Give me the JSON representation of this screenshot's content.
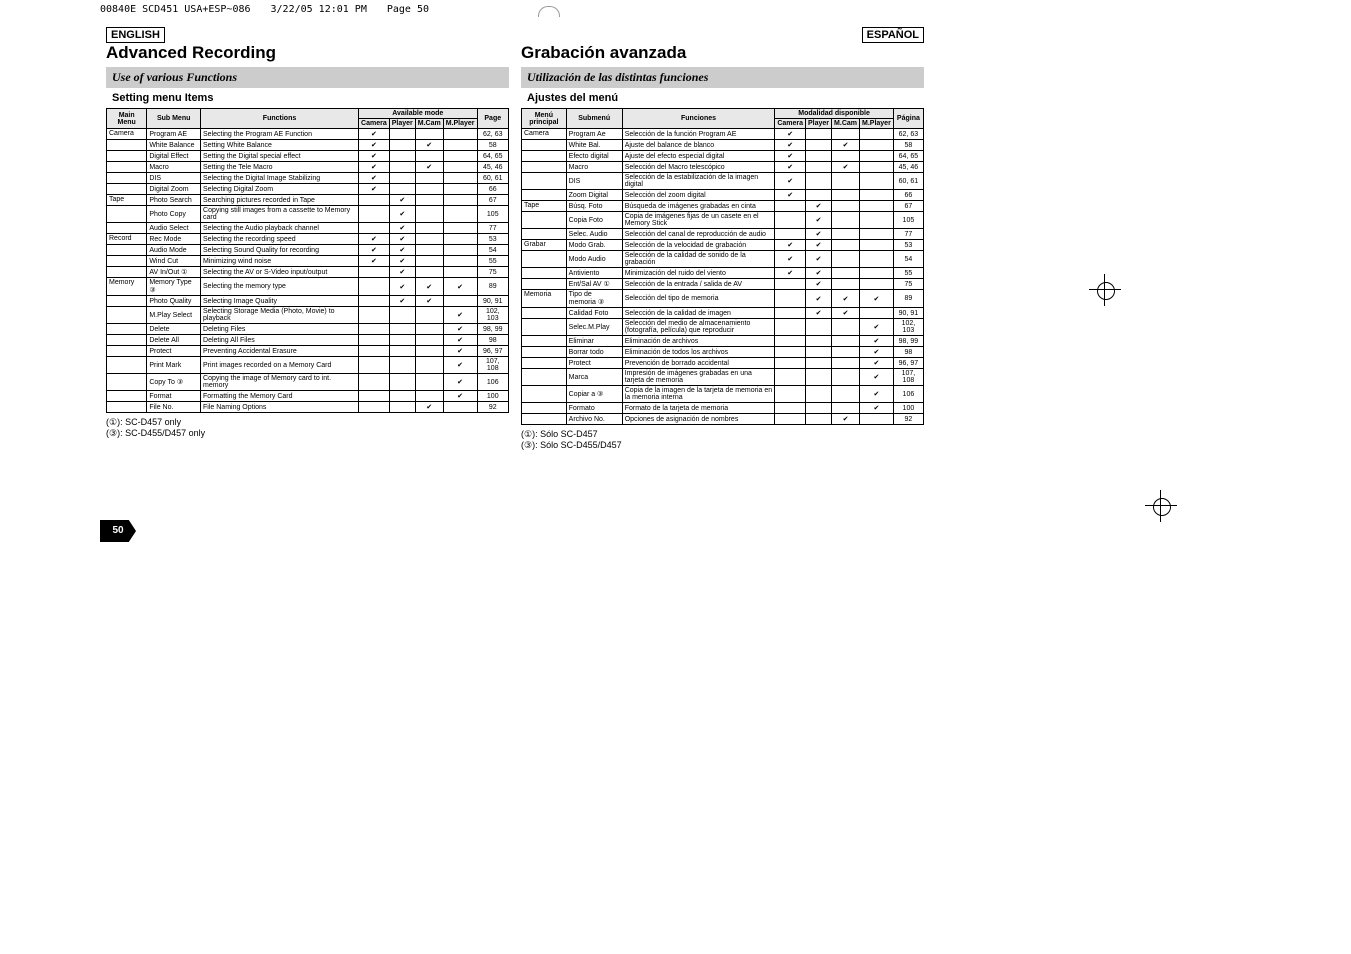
{
  "meta": {
    "filename": "00840E SCD451 USA+ESP~086",
    "date": "3/22/05 12:01 PM",
    "pg": "Page 50"
  },
  "pageNumber": "50",
  "helper": {
    "check": "✔"
  },
  "left": {
    "lang": "ENGLISH",
    "title": "Advanced Recording",
    "subtitle": "Use of various Functions",
    "section": "Setting menu Items",
    "headers": {
      "main": "Main Menu",
      "sub": "Sub Menu",
      "func": "Functions",
      "avail": "Available mode",
      "cam": "Camera",
      "player": "Player",
      "mcam": "M.Cam",
      "mplayer": "M.Player",
      "page": "Page"
    },
    "rows": [
      {
        "main": "Camera",
        "sub": "Program AE",
        "func": "Selecting the Program AE Function",
        "m": [
          1,
          0,
          0,
          0
        ],
        "pg": "62, 63"
      },
      {
        "main": "",
        "sub": "White Balance",
        "func": "Setting White Balance",
        "m": [
          1,
          0,
          1,
          0
        ],
        "pg": "58"
      },
      {
        "main": "",
        "sub": "Digital Effect",
        "func": "Setting the Digital special effect",
        "m": [
          1,
          0,
          0,
          0
        ],
        "pg": "64, 65"
      },
      {
        "main": "",
        "sub": "Macro",
        "func": "Setting the Tele Macro",
        "m": [
          1,
          0,
          1,
          0
        ],
        "pg": "45, 46"
      },
      {
        "main": "",
        "sub": "DIS",
        "func": "Selecting the Digital Image Stabilizing",
        "m": [
          1,
          0,
          0,
          0
        ],
        "pg": "60, 61"
      },
      {
        "main": "",
        "sub": "Digital Zoom",
        "func": "Selecting Digital Zoom",
        "m": [
          1,
          0,
          0,
          0
        ],
        "pg": "66"
      },
      {
        "main": "Tape",
        "sub": "Photo Search",
        "func": "Searching pictures recorded in Tape",
        "m": [
          0,
          1,
          0,
          0
        ],
        "pg": "67"
      },
      {
        "main": "",
        "sub": "Photo Copy",
        "func": "Copying still images from a cassette to Memory card",
        "m": [
          0,
          1,
          0,
          0
        ],
        "pg": "105"
      },
      {
        "main": "",
        "sub": "Audio Select",
        "func": "Selecting the Audio playback channel",
        "m": [
          0,
          1,
          0,
          0
        ],
        "pg": "77"
      },
      {
        "main": "Record",
        "sub": "Rec Mode",
        "func": "Selecting the recording speed",
        "m": [
          1,
          1,
          0,
          0
        ],
        "pg": "53"
      },
      {
        "main": "",
        "sub": "Audio Mode",
        "func": "Selecting Sound Quality for recording",
        "m": [
          1,
          1,
          0,
          0
        ],
        "pg": "54"
      },
      {
        "main": "",
        "sub": "Wind Cut",
        "func": "Minimizing wind noise",
        "m": [
          1,
          1,
          0,
          0
        ],
        "pg": "55"
      },
      {
        "main": "",
        "sub": "AV In/Out ①",
        "func": "Selecting the AV or S-Video input/output",
        "m": [
          0,
          1,
          0,
          0
        ],
        "pg": "75"
      },
      {
        "main": "Memory",
        "sub": "Memory Type ③",
        "func": "Selecting the memory type",
        "m": [
          0,
          1,
          1,
          1
        ],
        "pg": "89"
      },
      {
        "main": "",
        "sub": "Photo Quality",
        "func": "Selecting Image Quality",
        "m": [
          0,
          1,
          1,
          0
        ],
        "pg": "90, 91"
      },
      {
        "main": "",
        "sub": "M.Play Select",
        "func": "Selecting Storage Media (Photo, Movie) to playback",
        "m": [
          0,
          0,
          0,
          1
        ],
        "pg": "102, 103"
      },
      {
        "main": "",
        "sub": "Delete",
        "func": "Deleting Files",
        "m": [
          0,
          0,
          0,
          1
        ],
        "pg": "98, 99"
      },
      {
        "main": "",
        "sub": "Delete All",
        "func": "Deleting All Files",
        "m": [
          0,
          0,
          0,
          1
        ],
        "pg": "98"
      },
      {
        "main": "",
        "sub": "Protect",
        "func": "Preventing Accidental Erasure",
        "m": [
          0,
          0,
          0,
          1
        ],
        "pg": "96, 97"
      },
      {
        "main": "",
        "sub": "Print Mark",
        "func": "Print images recorded on a Memory Card",
        "m": [
          0,
          0,
          0,
          1
        ],
        "pg": "107, 108"
      },
      {
        "main": "",
        "sub": "Copy To ③",
        "func": "Copying the image of Memory card to int. memory",
        "m": [
          0,
          0,
          0,
          1
        ],
        "pg": "106"
      },
      {
        "main": "",
        "sub": "Format",
        "func": "Formatting the Memory Card",
        "m": [
          0,
          0,
          0,
          1
        ],
        "pg": "100"
      },
      {
        "main": "",
        "sub": "File No.",
        "func": "File Naming Options",
        "m": [
          0,
          0,
          1,
          0
        ],
        "pg": "92"
      }
    ],
    "notes": [
      "(①): SC-D457 only",
      "(③): SC-D455/D457 only"
    ]
  },
  "right": {
    "lang": "ESPAÑOL",
    "title": "Grabación avanzada",
    "subtitle": "Utilización de las distintas funciones",
    "section": "Ajustes del menú",
    "headers": {
      "main": "Menú principal",
      "sub": "Submenú",
      "func": "Funciones",
      "avail": "Modalidad disponible",
      "cam": "Camera",
      "player": "Player",
      "mcam": "M.Cam",
      "mplayer": "M.Player",
      "page": "Página"
    },
    "rows": [
      {
        "main": "Camera",
        "sub": "Program Ae",
        "func": "Selección de la función Program AE",
        "m": [
          1,
          0,
          0,
          0
        ],
        "pg": "62, 63"
      },
      {
        "main": "",
        "sub": "White Bal.",
        "func": "Ajuste del balance de blanco",
        "m": [
          1,
          0,
          1,
          0
        ],
        "pg": "58"
      },
      {
        "main": "",
        "sub": "Efecto digital",
        "func": "Ajuste del efecto especial digital",
        "m": [
          1,
          0,
          0,
          0
        ],
        "pg": "64, 65"
      },
      {
        "main": "",
        "sub": "Macro",
        "func": "Selección del Macro telescópico",
        "m": [
          1,
          0,
          1,
          0
        ],
        "pg": "45, 46"
      },
      {
        "main": "",
        "sub": "DIS",
        "func": "Selección de la estabilización de la imagen digital",
        "m": [
          1,
          0,
          0,
          0
        ],
        "pg": "60, 61"
      },
      {
        "main": "",
        "sub": "Zoom Digital",
        "func": "Selección del zoom digital",
        "m": [
          1,
          0,
          0,
          0
        ],
        "pg": "66"
      },
      {
        "main": "Tape",
        "sub": "Búsq. Foto",
        "func": "Búsqueda de imágenes grabadas en cinta",
        "m": [
          0,
          1,
          0,
          0
        ],
        "pg": "67"
      },
      {
        "main": "",
        "sub": "Copia Foto",
        "func": "Copia de imágenes fijas de un casete en el Memory Stick",
        "m": [
          0,
          1,
          0,
          0
        ],
        "pg": "105"
      },
      {
        "main": "",
        "sub": "Selec. Audio",
        "func": "Selección del canal de reproducción de audio",
        "m": [
          0,
          1,
          0,
          0
        ],
        "pg": "77"
      },
      {
        "main": "Grabar",
        "sub": "Modo Grab.",
        "func": "Selección de la velocidad de grabación",
        "m": [
          1,
          1,
          0,
          0
        ],
        "pg": "53"
      },
      {
        "main": "",
        "sub": "Modo Audio",
        "func": "Selección de la calidad de sonido de la grabación",
        "m": [
          1,
          1,
          0,
          0
        ],
        "pg": "54"
      },
      {
        "main": "",
        "sub": "Antiviento",
        "func": "Minimización del ruido del viento",
        "m": [
          1,
          1,
          0,
          0
        ],
        "pg": "55"
      },
      {
        "main": "",
        "sub": "Ent/Sal AV ①",
        "func": "Selección de la entrada / salida de AV",
        "m": [
          0,
          1,
          0,
          0
        ],
        "pg": "75"
      },
      {
        "main": "Memoria",
        "sub": "Tipo de memoria ③",
        "func": "Selección del tipo de memoria",
        "m": [
          0,
          1,
          1,
          1
        ],
        "pg": "89"
      },
      {
        "main": "",
        "sub": "Calidad Foto",
        "func": "Selección de la calidad de imagen",
        "m": [
          0,
          1,
          1,
          0
        ],
        "pg": "90, 91"
      },
      {
        "main": "",
        "sub": "Selec.M.Play",
        "func": "Selección del medio de almacenamiento (fotografía, película) que reproducir",
        "m": [
          0,
          0,
          0,
          1
        ],
        "pg": "102, 103"
      },
      {
        "main": "",
        "sub": "Eliminar",
        "func": "Eliminación de archivos",
        "m": [
          0,
          0,
          0,
          1
        ],
        "pg": "98, 99"
      },
      {
        "main": "",
        "sub": "Borrar todo",
        "func": "Eliminación de todos los archivos",
        "m": [
          0,
          0,
          0,
          1
        ],
        "pg": "98"
      },
      {
        "main": "",
        "sub": "Protect",
        "func": "Prevención de borrado accidental",
        "m": [
          0,
          0,
          0,
          1
        ],
        "pg": "96, 97"
      },
      {
        "main": "",
        "sub": "Marca",
        "func": "Impresión de imágenes grabadas en una tarjeta de memoria",
        "m": [
          0,
          0,
          0,
          1
        ],
        "pg": "107, 108"
      },
      {
        "main": "",
        "sub": "Copiar a ③",
        "func": "Copia de la imagen de la tarjeta de memoria en la memoria interna",
        "m": [
          0,
          0,
          0,
          1
        ],
        "pg": "106"
      },
      {
        "main": "",
        "sub": "Formato",
        "func": "Formato de la tarjeta de memoria",
        "m": [
          0,
          0,
          0,
          1
        ],
        "pg": "100"
      },
      {
        "main": "",
        "sub": "Archivo No.",
        "func": "Opciones de asignación de nombres",
        "m": [
          0,
          0,
          1,
          0
        ],
        "pg": "92"
      }
    ],
    "notes": [
      "(①): Sólo SC-D457",
      "(③): Sólo SC-D455/D457"
    ]
  }
}
